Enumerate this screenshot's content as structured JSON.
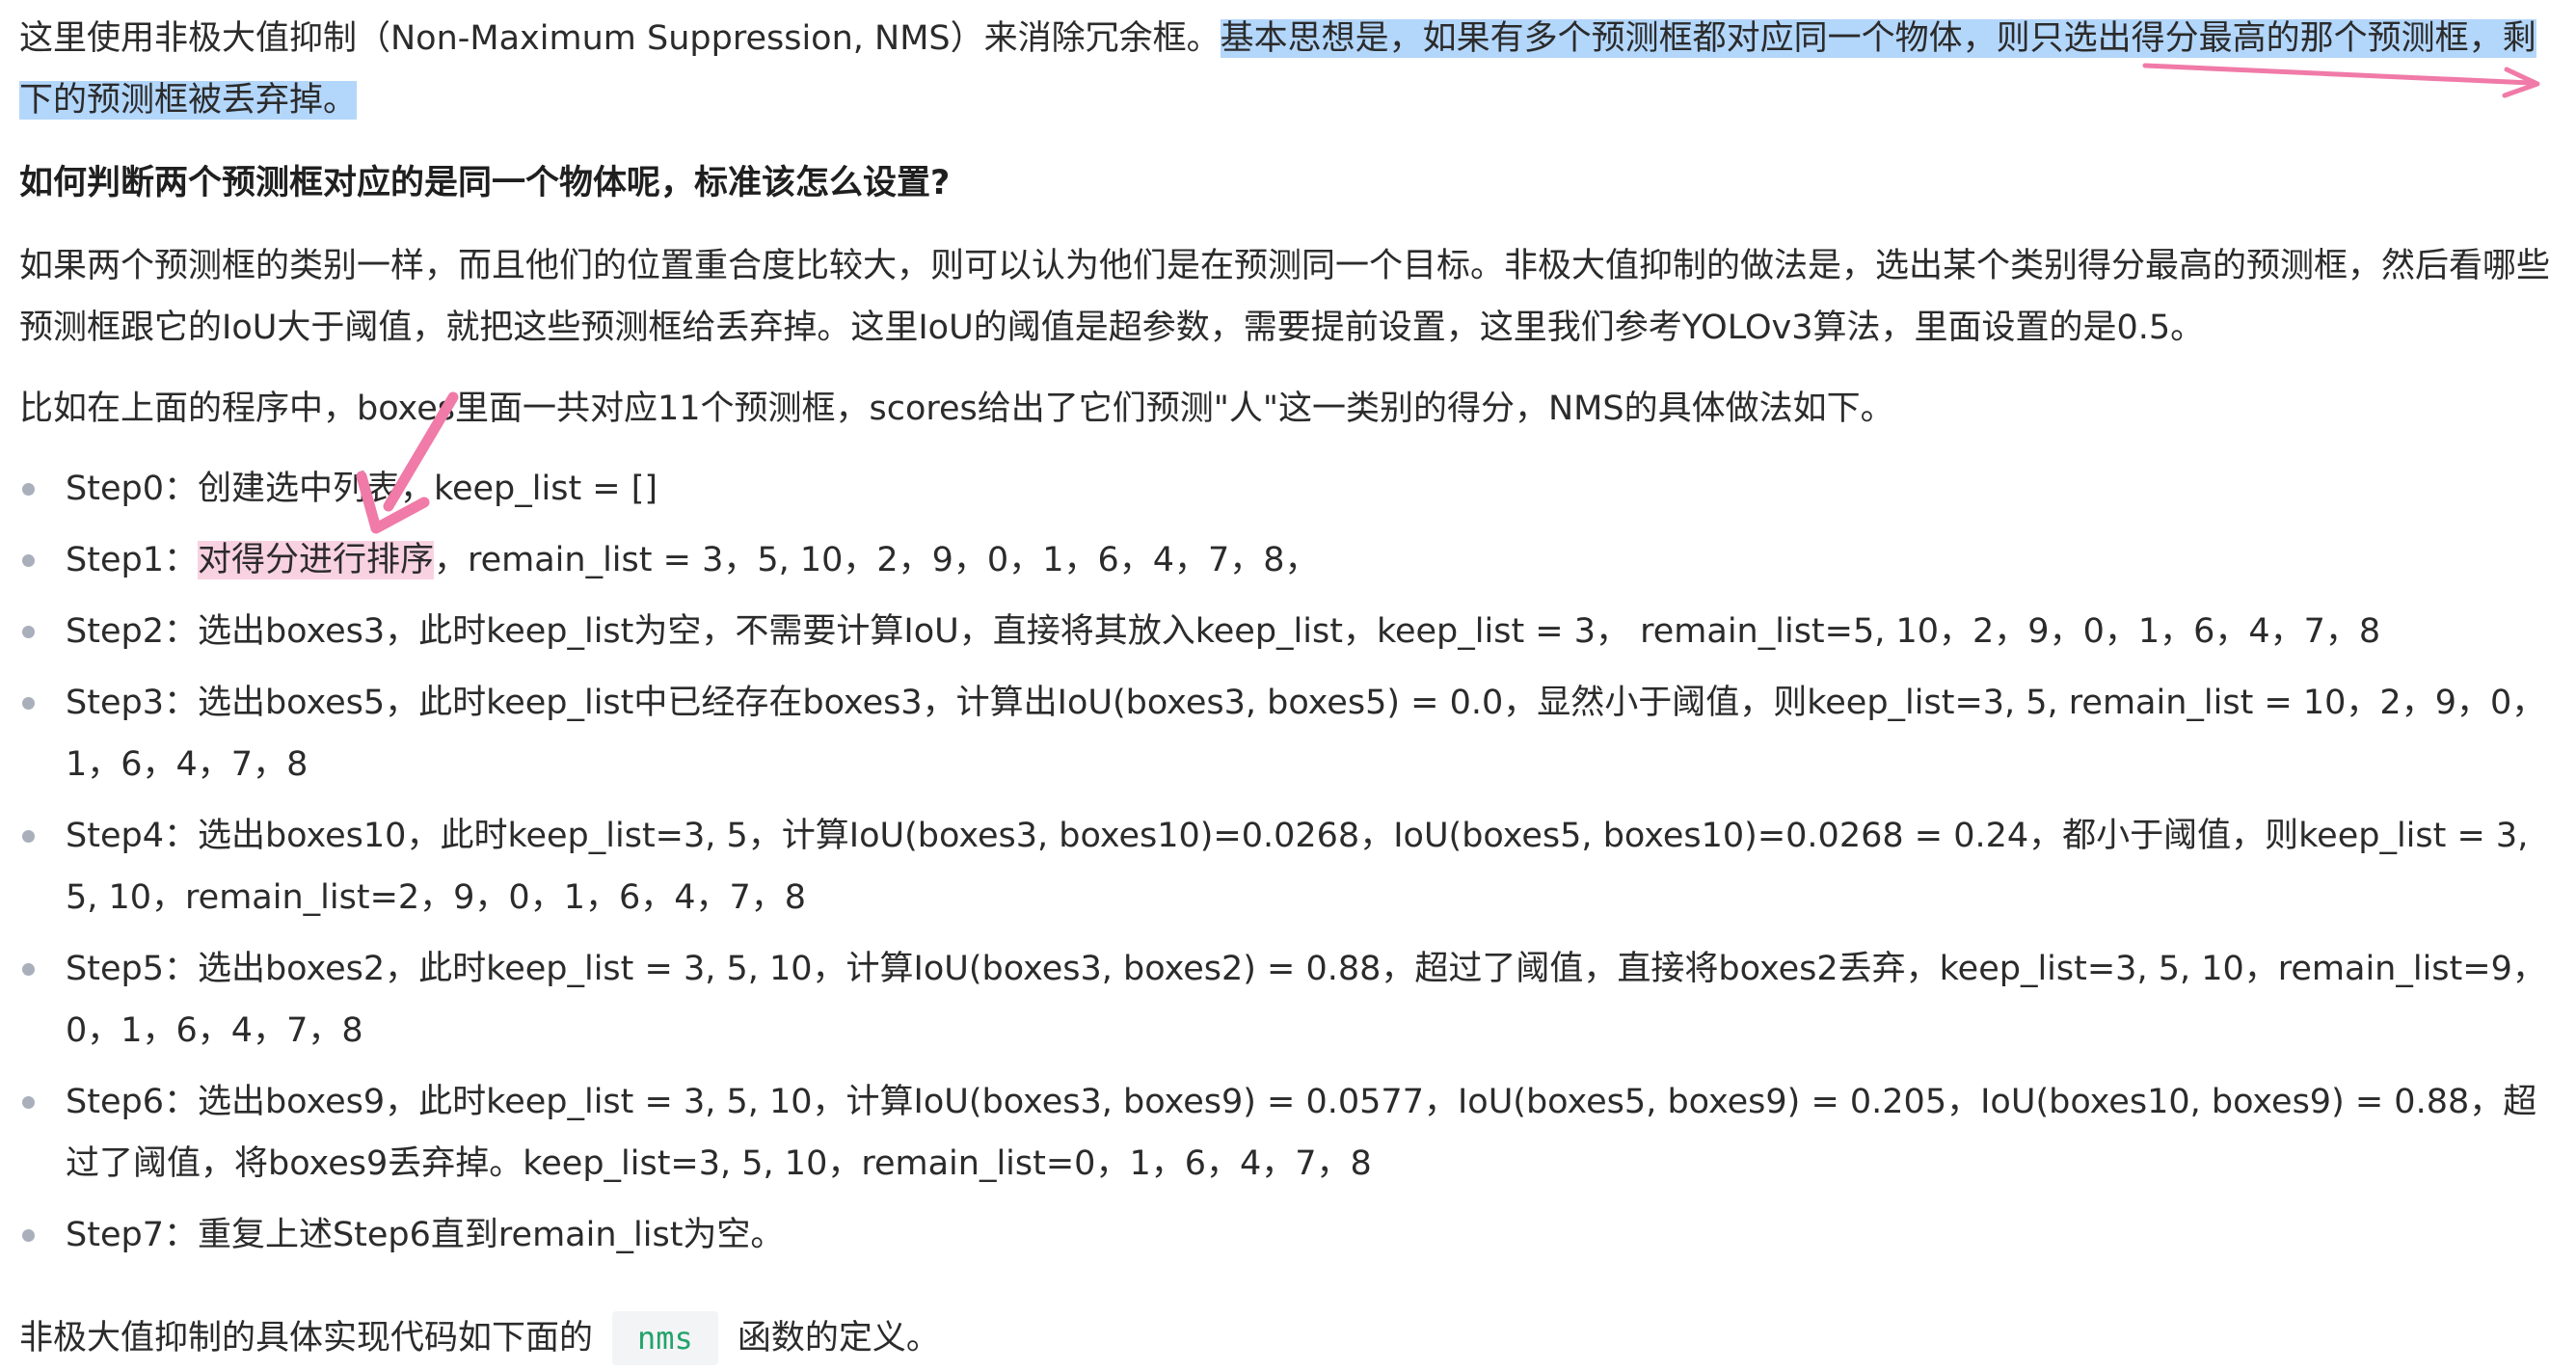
{
  "intro": {
    "part1": "这里使用非极大值抑制（Non-Maximum Suppression, NMS）来消除冗余框。",
    "highlight": "基本思想是，如果有多个预测框都对应同一个物体，则只选出得分最高的那个预测框，剩下的预测框被丢弃掉。"
  },
  "question_heading": "如何判断两个预测框对应的是同一个物体呢，标准该怎么设置?",
  "explanation": "如果两个预测框的类别一样，而且他们的位置重合度比较大，则可以认为他们是在预测同一个目标。非极大值抑制的做法是，选出某个类别得分最高的预测框，然后看哪些预测框跟它的IoU大于阈值，就把这些预测框给丢弃掉。这里IoU的阈值是超参数，需要提前设置，这里我们参考YOLOv3算法，里面设置的是0.5。",
  "example_intro": "比如在上面的程序中，boxes里面一共对应11个预测框，scores给出了它们预测\"人\"这一类别的得分，NMS的具体做法如下。",
  "steps": [
    {
      "text": "Step0：创建选中列表，keep_list = []"
    },
    {
      "prefix": "Step1：",
      "highlight": "对得分进行排序",
      "suffix": "，remain_list = 3，5, 10，2，9，0，1，6，4，7，8，"
    },
    {
      "text": "Step2：选出boxes3，此时keep_list为空，不需要计算IoU，直接将其放入keep_list，keep_list = 3， remain_list=5, 10，2，9，0，1，6，4，7，8"
    },
    {
      "text": "Step3：选出boxes5，此时keep_list中已经存在boxes3，计算出IoU(boxes3, boxes5) = 0.0，显然小于阈值，则keep_list=3, 5, remain_list = 10，2，9，0，1，6，4，7，8"
    },
    {
      "text": "Step4：选出boxes10，此时keep_list=3, 5，计算IoU(boxes3, boxes10)=0.0268，IoU(boxes5, boxes10)=0.0268 = 0.24，都小于阈值，则keep_list = 3, 5, 10，remain_list=2，9，0，1，6，4，7，8"
    },
    {
      "text": "Step5：选出boxes2，此时keep_list = 3, 5, 10，计算IoU(boxes3, boxes2) = 0.88，超过了阈值，直接将boxes2丢弃，keep_list=3, 5, 10，remain_list=9，0，1，6，4，7，8"
    },
    {
      "text": "Step6：选出boxes9，此时keep_list = 3, 5, 10，计算IoU(boxes3, boxes9) = 0.0577，IoU(boxes5, boxes9) = 0.205，IoU(boxes10, boxes9) = 0.88，超过了阈值，将boxes9丢弃掉。keep_list=3, 5, 10，remain_list=0，1，6，4，7，8"
    },
    {
      "text": "Step7：重复上述Step6直到remain_list为空。"
    }
  ],
  "footer": {
    "before": "非极大值抑制的具体实现代码如下面的",
    "code": "nms",
    "after": "函数的定义。"
  },
  "colors": {
    "highlight_blue": "#b3d6fb",
    "highlight_pink": "#f9d2e1",
    "annotation_pink": "#f07aa8",
    "code_green": "#22a36b"
  }
}
